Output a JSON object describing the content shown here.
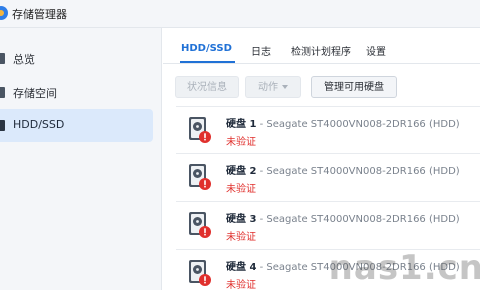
{
  "window": {
    "title": "存储管理器"
  },
  "sidebar": {
    "items": [
      {
        "label": "总览",
        "icon": "overview-icon",
        "active": false
      },
      {
        "label": "存储空间",
        "icon": "storage-pool-icon",
        "active": false
      },
      {
        "label": "HDD/SSD",
        "icon": "hdd-icon",
        "active": true
      }
    ]
  },
  "tabs": [
    {
      "label": "HDD/SSD",
      "active": true
    },
    {
      "label": "日志",
      "active": false
    },
    {
      "label": "检测计划程序",
      "active": false
    },
    {
      "label": "设置",
      "active": false
    }
  ],
  "toolbar": {
    "status_info": "状况信息",
    "action": "动作",
    "manage_available": "管理可用硬盘"
  },
  "disks": [
    {
      "name": "硬盘 1",
      "separator": " - ",
      "model": "Seagate ST4000VN008-2DR166 (HDD)",
      "status": "未验证"
    },
    {
      "name": "硬盘 2",
      "separator": " - ",
      "model": "Seagate ST4000VN008-2DR166 (HDD)",
      "status": "未验证"
    },
    {
      "name": "硬盘 3",
      "separator": " - ",
      "model": "Seagate ST4000VN008-2DR166 (HDD)",
      "status": "未验证"
    },
    {
      "name": "硬盘 4",
      "separator": " - ",
      "model": "Seagate ST4000VN008-2DR166 (HDD)",
      "status": "未验证"
    }
  ],
  "colors": {
    "accent": "#2071d6",
    "warning": "#e0302d",
    "sidebar_active": "#dbe9fb"
  },
  "watermark": "nas1.cn"
}
